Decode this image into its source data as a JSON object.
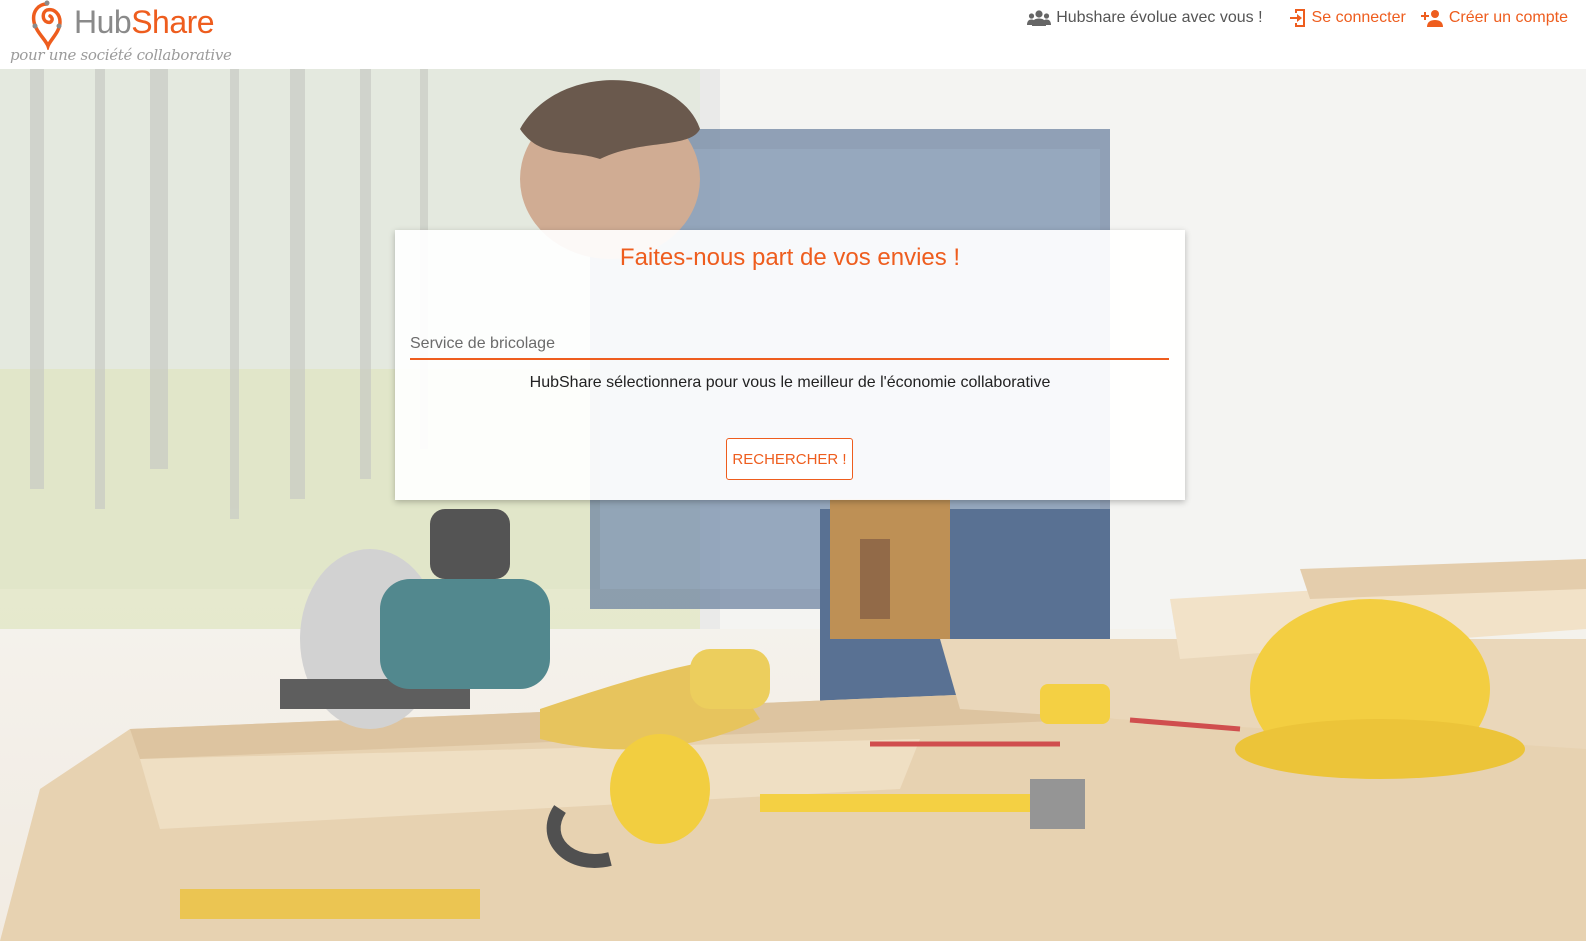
{
  "brand": {
    "name_part1": "Hub",
    "name_part2": "Share",
    "tagline": "pour une société collaborative",
    "accent_color": "#ee5d1e"
  },
  "nav": {
    "evolve": {
      "label": "Hubshare évolue avec vous !",
      "icon": "group-icon"
    },
    "login": {
      "label": "Se connecter",
      "icon": "login-icon"
    },
    "signup": {
      "label": "Créer un compte",
      "icon": "add-user-icon"
    }
  },
  "search": {
    "title": "Faites-nous part de vos envies !",
    "placeholder": "Service de bricolage",
    "subtitle": "HubShare sélectionnera pour vous le meilleur de l'économie collaborative",
    "button_label": "RECHERCHER !"
  }
}
